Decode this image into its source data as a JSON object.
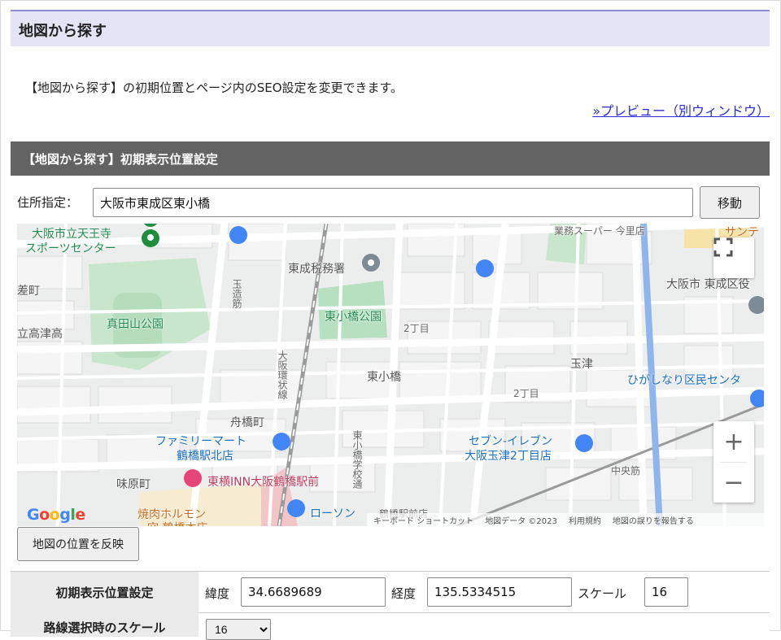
{
  "page": {
    "title": "地図から探す",
    "description": "【地図から探す】の初期位置とページ内のSEO設定を変更できます。",
    "preview_link": "»プレビュー（別ウィンドウ）"
  },
  "section": {
    "title": "【地図から探す】初期表示位置設定",
    "address_label": "住所指定：",
    "address_value": "大阪市東成区東小橋",
    "move_button": "移動",
    "reflect_button": "地図の位置を反映"
  },
  "map": {
    "labels": {
      "park1": "大阪市立天王寺",
      "park1b": "スポーツセンター",
      "park2": "真田山公園",
      "park3": "東小橋公園",
      "tax": "東成税務署",
      "town1": "東小橋",
      "town2": "玉津",
      "town3": "舟橋町",
      "town4": "味原町",
      "town5": "大阪市 東成区役",
      "town6": "ひがしなり区民センタ",
      "town7": "中央筋",
      "chome1": "2丁目",
      "chome2": "2丁目",
      "west1": "差町",
      "west2": "立高津高",
      "road1": "玉造筋",
      "road2": "大阪環状線",
      "road3": "東小橋学校通",
      "store1": "ファミリーマート",
      "store1b": "鶴橋駅北店",
      "store2": "セブン-イレブン",
      "store2b": "大阪玉津2丁目店",
      "hotel": "東横INN大阪鶴橋駅前",
      "lawson": "ローソン",
      "lawson2": "鶴橋駅前店",
      "yakiniku": "焼肉ホルモン",
      "yakiniku2": "空 鶴橋本店",
      "gyomu": "業務スーパー 今里店",
      "sun": "サンテ"
    },
    "attribution": {
      "shortcuts": "キーボード ショートカット",
      "data": "地図データ ©2023",
      "terms": "利用規約",
      "report": "地図の誤りを報告する"
    },
    "zoom_in": "+",
    "zoom_out": "−",
    "google": "Google"
  },
  "settings": {
    "initial_label": "初期表示位置設定",
    "lat_label": "緯度",
    "lat_value": "34.6689689",
    "lng_label": "経度",
    "lng_value": "135.5334515",
    "scale_label": "スケール",
    "scale_value": "16",
    "route_label": "路線選択時のスケール",
    "route_scale_value": "16"
  }
}
